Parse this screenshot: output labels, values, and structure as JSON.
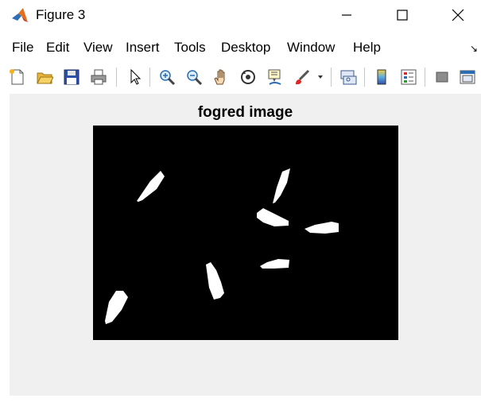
{
  "window": {
    "title": "Figure 3",
    "controls": [
      "minimize",
      "maximize",
      "close"
    ]
  },
  "menubar": {
    "items": [
      "File",
      "Edit",
      "View",
      "Insert",
      "Tools",
      "Desktop",
      "Window",
      "Help"
    ],
    "overflow_arrow": "↘"
  },
  "toolbar": {
    "buttons": [
      "new-figure-icon",
      "open-file-icon",
      "save-icon",
      "print-icon",
      "select-arrow-icon",
      "zoom-in-icon",
      "zoom-out-icon",
      "pan-hand-icon",
      "rotate-3d-icon",
      "data-cursor-icon",
      "brush-icon",
      "link-plot-icon",
      "colorbar-icon",
      "legend-icon",
      "hide-plot-tools-icon",
      "show-plot-tools-icon"
    ]
  },
  "figure": {
    "title": "fogred image",
    "background": "#000000",
    "blob_color": "#ffffff",
    "canvas_color": "#f0f0f0"
  }
}
